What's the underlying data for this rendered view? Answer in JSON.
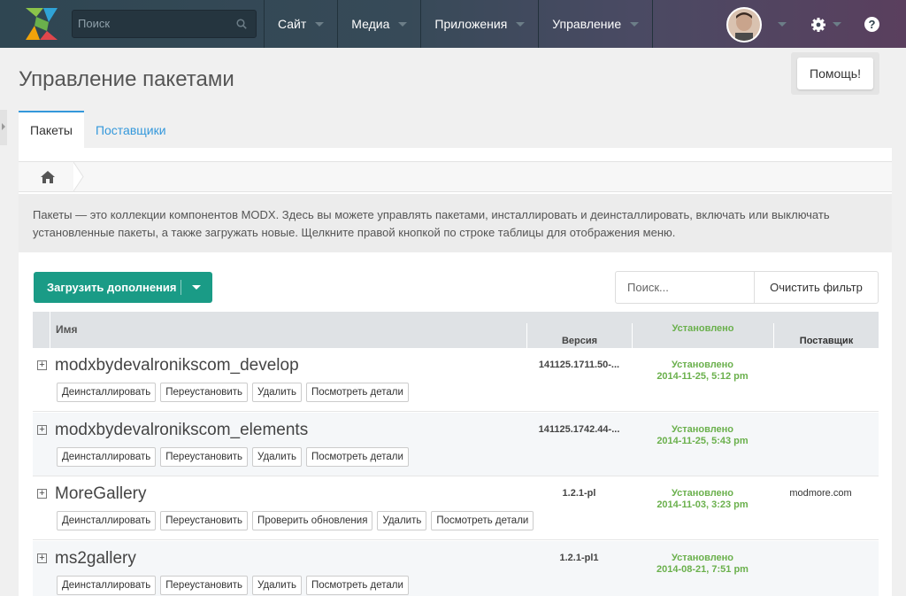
{
  "topbar": {
    "search_placeholder": "Поиск",
    "nav": [
      {
        "label": "Сайт"
      },
      {
        "label": "Медиа"
      },
      {
        "label": "Приложения"
      },
      {
        "label": "Управление"
      }
    ],
    "help_label": "?"
  },
  "page": {
    "title": "Управление пакетами",
    "help_button": "Помощь!",
    "tabs": [
      {
        "label": "Пакеты",
        "active": true
      },
      {
        "label": "Поставщики",
        "active": false
      }
    ],
    "description": "Пакеты — это коллекции компонентов MODX. Здесь вы можете управлять пакетами, инсталлировать и деинсталлировать, включать или выключать установленные пакеты, а также загружать новые. Щелкните правой кнопкой по строке таблицы для отображения меню."
  },
  "toolbar": {
    "upload_label": "Загрузить дополнения",
    "filter_placeholder": "Поиск...",
    "clear_filter_label": "Очистить фильтр"
  },
  "grid": {
    "columns": {
      "name": "Имя",
      "version": "Версия",
      "installed": "Установлено",
      "provider": "Поставщик"
    },
    "rows": [
      {
        "name": "modxbydevalronikscom_develop",
        "version": "141125.1711.50-...",
        "status": "Установлено",
        "date": "2014-11-25, 5:12 pm",
        "provider": "",
        "actions": [
          "Деинсталлировать",
          "Переустановить",
          "Удалить",
          "Посмотреть детали"
        ]
      },
      {
        "name": "modxbydevalronikscom_elements",
        "version": "141125.1742.44-...",
        "status": "Установлено",
        "date": "2014-11-25, 5:43 pm",
        "provider": "",
        "actions": [
          "Деинсталлировать",
          "Переустановить",
          "Удалить",
          "Посмотреть детали"
        ]
      },
      {
        "name": "MoreGallery",
        "version": "1.2.1-pl",
        "status": "Установлено",
        "date": "2014-11-03, 3:23 pm",
        "provider": "modmore.com",
        "actions": [
          "Деинсталлировать",
          "Переустановить",
          "Проверить обновления",
          "Удалить",
          "Посмотреть детали"
        ]
      },
      {
        "name": "ms2gallery",
        "version": "1.2.1-pl1",
        "status": "Установлено",
        "date": "2014-08-21, 7:51 pm",
        "provider": "",
        "actions": [
          "Деинсталлировать",
          "Переустановить",
          "Удалить",
          "Посмотреть детали"
        ]
      }
    ]
  },
  "colors": {
    "accent": "#3498db",
    "primary_button": "#1a9b86",
    "installed_status": "#6ab04c"
  }
}
